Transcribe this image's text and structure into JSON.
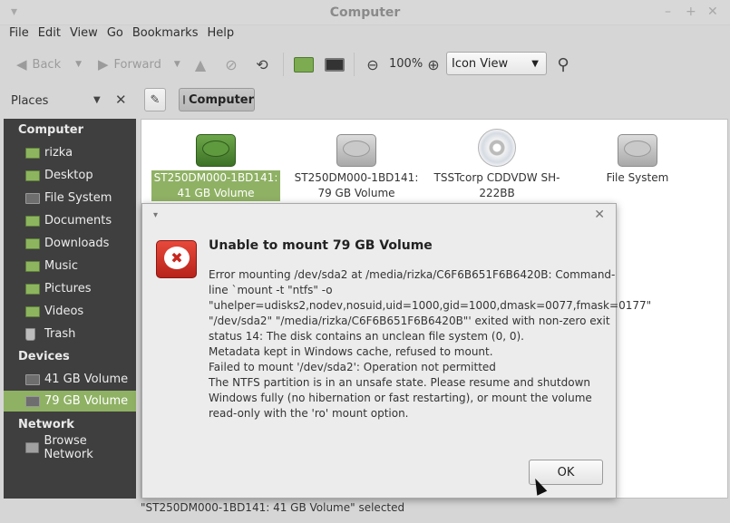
{
  "window": {
    "title": "Computer"
  },
  "menu": [
    "File",
    "Edit",
    "View",
    "Go",
    "Bookmarks",
    "Help"
  ],
  "toolbar": {
    "back": "Back",
    "forward": "Forward",
    "zoom": "100%",
    "view_mode": "Icon View"
  },
  "places_bar": {
    "label": "Places",
    "location": "Computer"
  },
  "sidebar": {
    "computer_header": "Computer",
    "computer_items": [
      "rizka",
      "Desktop",
      "File System",
      "Documents",
      "Downloads",
      "Music",
      "Pictures",
      "Videos",
      "Trash"
    ],
    "devices_header": "Devices",
    "device_items": [
      "41 GB Volume",
      "79 GB Volume"
    ],
    "network_header": "Network",
    "network_items": [
      "Browse Network"
    ]
  },
  "files": [
    {
      "line1": "ST250DM000-1BD141:",
      "line2": "41 GB Volume"
    },
    {
      "line1": "ST250DM000-1BD141:",
      "line2": "79 GB Volume"
    },
    {
      "line1": "TSSTcorp CDDVDW SH-",
      "line2": "222BB"
    },
    {
      "line1": "File System",
      "line2": ""
    }
  ],
  "status": "\"ST250DM000-1BD141: 41 GB Volume\" selected",
  "dialog": {
    "title": "Unable to mount 79 GB Volume",
    "lines": [
      "Error mounting /dev/sda2 at /media/rizka/C6F6B651F6B6420B: Command-",
      "line `mount -t \"ntfs\" -o",
      "\"uhelper=udisks2,nodev,nosuid,uid=1000,gid=1000,dmask=0077,fmask=0177\"",
      "\"/dev/sda2\" \"/media/rizka/C6F6B651F6B6420B\"' exited with non-zero exit",
      "status 14: The disk contains an unclean file system (0, 0).",
      "Metadata kept in Windows cache, refused to mount.",
      "Failed to mount '/dev/sda2': Operation not permitted",
      "The NTFS partition is in an unsafe state. Please resume and shutdown",
      "Windows fully (no hibernation or fast restarting), or mount the volume",
      "read-only with the 'ro' mount option."
    ],
    "ok": "OK"
  }
}
